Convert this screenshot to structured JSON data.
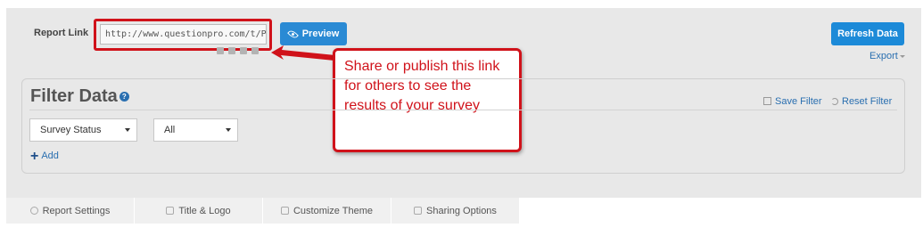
{
  "report_link": {
    "label": "Report Link",
    "url": "http://www.questionpro.com/t/PBI"
  },
  "preview_button": {
    "label": "Preview",
    "icon": "eye-icon"
  },
  "social_icons": [
    "facebook-icon",
    "twitter-icon",
    "linkedin-icon",
    "email-icon"
  ],
  "callout": {
    "text": "Share or publish this link for others to see the results of your survey",
    "color": "#d0121a"
  },
  "refresh_button": {
    "label": "Refresh Data"
  },
  "export": {
    "label": "Export"
  },
  "filter": {
    "title": "Filter Data",
    "help_icon": "?",
    "save_label": "Save Filter",
    "reset_label": "Reset Filter",
    "select_status": "Survey Status",
    "select_value": "All",
    "add_label": "Add",
    "add_icon": "+"
  },
  "tabs": [
    {
      "label": "Report Settings",
      "icon": "gears-icon"
    },
    {
      "label": "Title & Logo",
      "icon": "edit-icon"
    },
    {
      "label": "Customize Theme",
      "icon": "edit-icon"
    },
    {
      "label": "Sharing Options",
      "icon": "share-icon"
    }
  ],
  "colors": {
    "accent": "#2a8ad4",
    "highlight": "#d0121a",
    "panel": "#e8e8e8"
  }
}
